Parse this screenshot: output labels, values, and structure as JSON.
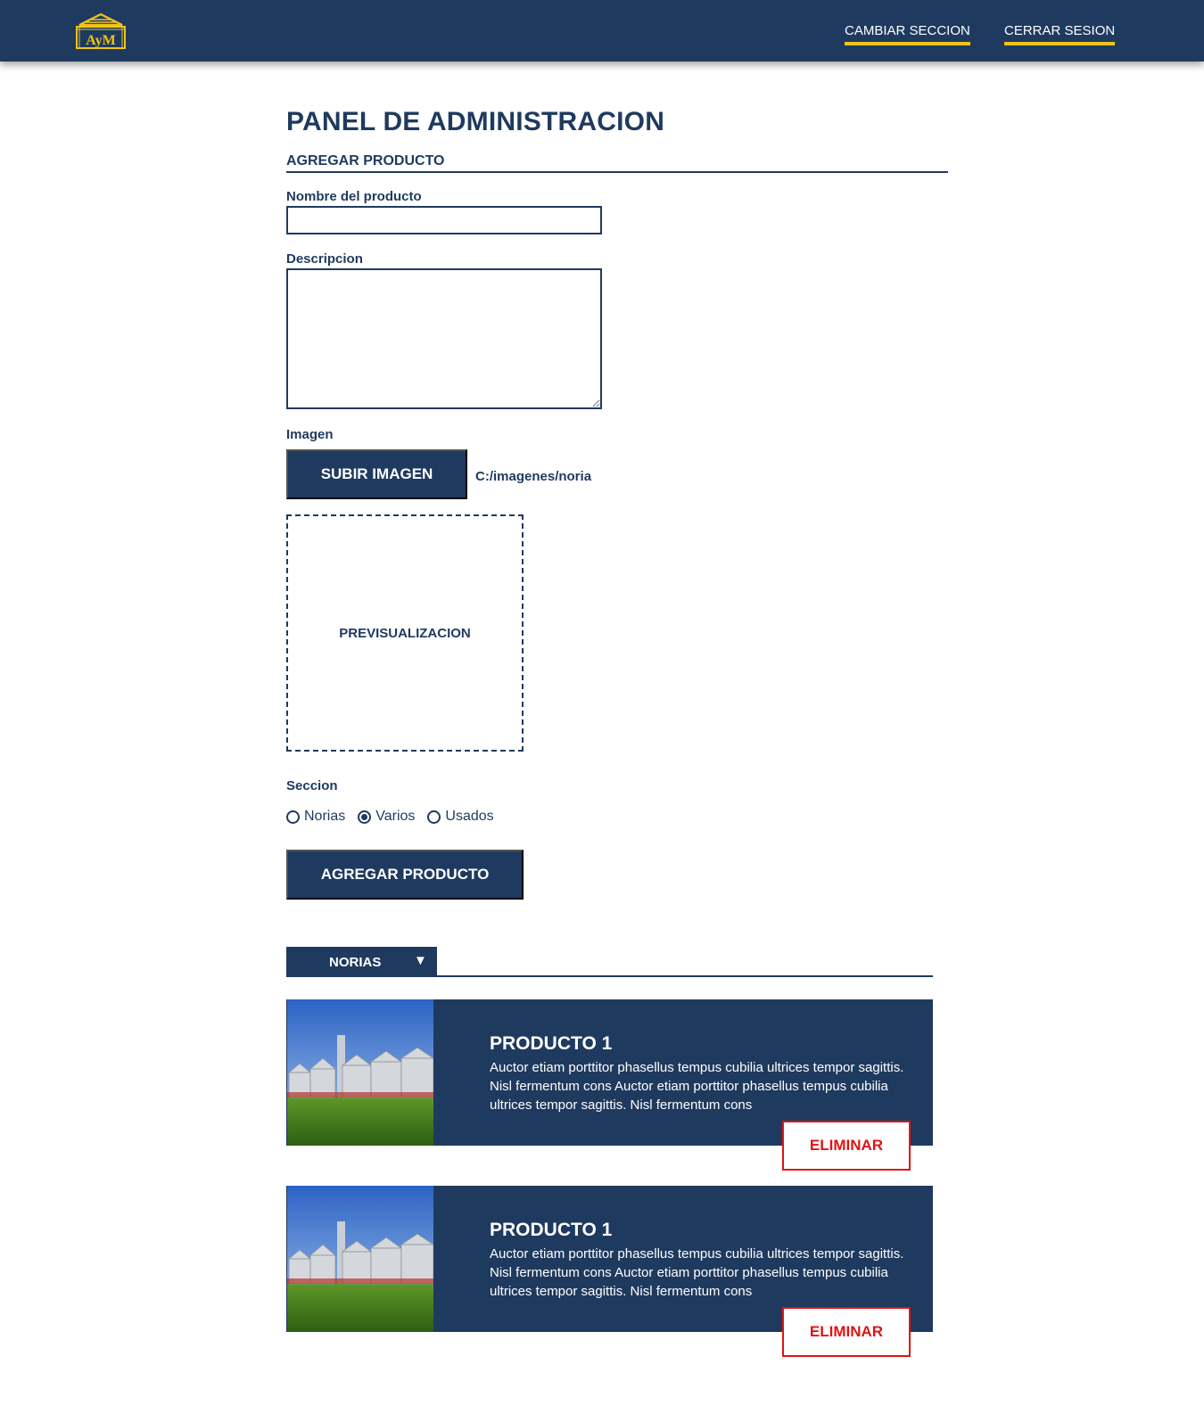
{
  "header": {
    "logo_text": "AyM",
    "nav": [
      {
        "label": "CAMBIAR SECCION"
      },
      {
        "label": "CERRAR SESION"
      }
    ]
  },
  "main": {
    "title": "PANEL DE ADMINISTRACION",
    "form": {
      "heading": "AGREGAR PRODUCTO",
      "name_label": "Nombre del producto",
      "name_value": "",
      "description_label": "Descripcion",
      "description_value": "",
      "image_label": "Imagen",
      "upload_button": "SUBIR IMAGEN",
      "file_path": "C:/imagenes/noria",
      "preview_label": "PREVISUALIZACION",
      "section_label": "Seccion",
      "section_options": [
        {
          "label": "Norias",
          "checked": false
        },
        {
          "label": "Varios",
          "checked": true
        },
        {
          "label": "Usados",
          "checked": false
        }
      ],
      "submit_button": "AGREGAR PRODUCTO"
    },
    "listing": {
      "filter_value": "NORIAS",
      "products": [
        {
          "title": "PRODUCTO 1",
          "description": "Auctor etiam porttitor phasellus tempus cubilia ultrices tempor sagittis. Nisl fermentum cons Auctor etiam porttitor phasellus tempus cubilia ultrices tempor sagittis. Nisl fermentum cons",
          "delete_button": "ELIMINAR"
        },
        {
          "title": "PRODUCTO 1",
          "description": "Auctor etiam porttitor phasellus tempus cubilia ultrices tempor sagittis. Nisl fermentum cons Auctor etiam porttitor phasellus tempus cubilia ultrices tempor sagittis. Nisl fermentum cons",
          "delete_button": "ELIMINAR"
        }
      ]
    }
  },
  "colors": {
    "primary": "#1f3a5f",
    "accent": "#f2c418",
    "danger": "#e01414",
    "background": "#ffffff"
  }
}
